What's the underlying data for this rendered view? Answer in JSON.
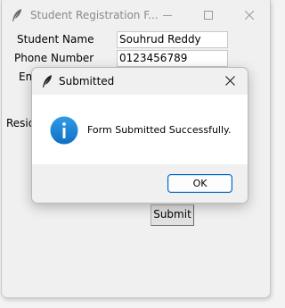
{
  "window": {
    "title": "Student Registration F...",
    "icon": "feather-icon",
    "controls": [
      "minimize-icon",
      "maximize-icon",
      "close-icon"
    ]
  },
  "form": {
    "student_name_label": "Student Name",
    "student_name_value": "Souhrud Reddy",
    "phone_label": "Phone Number",
    "phone_value": "0123456789",
    "email_label_partial": "Em",
    "residence_label_partial": "Resid",
    "submit_label": "Submit"
  },
  "dialog": {
    "title": "Submitted",
    "icon": "feather-icon",
    "message_icon": "info-icon",
    "message": "Form Submitted Successfully.",
    "ok_label": "OK",
    "accent_color": "#0067c0",
    "info_color": "#1e88d6"
  }
}
